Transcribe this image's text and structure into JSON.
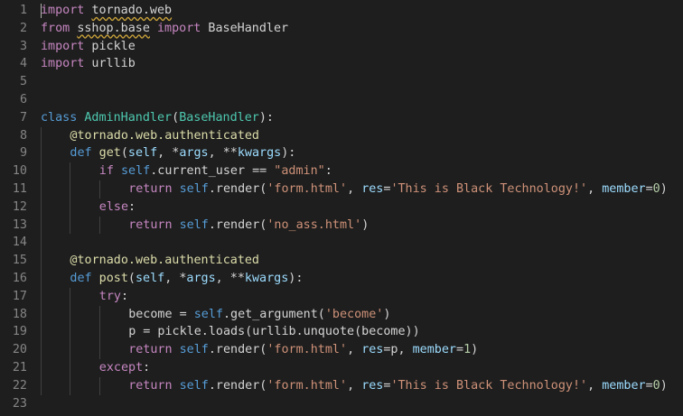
{
  "editor": {
    "language": "python",
    "theme_colors": {
      "background": "#1e1e1e",
      "line_number": "#858585",
      "keyword": "#c586c0",
      "storage_keyword": "#569cd6",
      "class_name": "#4ec9b0",
      "function": "#dcdcaa",
      "parameter": "#9cdcfe",
      "string": "#ce9178",
      "number": "#b5cea8",
      "text": "#d4d4d4",
      "squiggle": "#c9a23a"
    },
    "lines": [
      {
        "number": "1",
        "indent": 0,
        "tokens": [
          {
            "t": "import",
            "c": "kw"
          },
          {
            "t": " ",
            "c": "plain"
          },
          {
            "t": "tornado.web",
            "c": "plain",
            "wavy": true
          }
        ]
      },
      {
        "number": "2",
        "indent": 0,
        "tokens": [
          {
            "t": "from",
            "c": "kw"
          },
          {
            "t": " ",
            "c": "plain"
          },
          {
            "t": "sshop.base",
            "c": "plain",
            "wavy": true
          },
          {
            "t": " ",
            "c": "plain"
          },
          {
            "t": "import",
            "c": "kw"
          },
          {
            "t": " BaseHandler",
            "c": "plain"
          }
        ]
      },
      {
        "number": "3",
        "indent": 0,
        "tokens": [
          {
            "t": "import",
            "c": "kw"
          },
          {
            "t": " pickle",
            "c": "plain"
          }
        ]
      },
      {
        "number": "4",
        "indent": 0,
        "tokens": [
          {
            "t": "import",
            "c": "kw"
          },
          {
            "t": " urllib",
            "c": "plain"
          }
        ]
      },
      {
        "number": "5",
        "indent": 0,
        "tokens": []
      },
      {
        "number": "6",
        "indent": 0,
        "tokens": []
      },
      {
        "number": "7",
        "indent": 0,
        "tokens": [
          {
            "t": "class",
            "c": "kw2"
          },
          {
            "t": " ",
            "c": "plain"
          },
          {
            "t": "AdminHandler",
            "c": "cls"
          },
          {
            "t": "(",
            "c": "plain"
          },
          {
            "t": "BaseHandler",
            "c": "cls"
          },
          {
            "t": "):",
            "c": "plain"
          }
        ]
      },
      {
        "number": "8",
        "indent": 1,
        "tokens": [
          {
            "t": "@tornado.web.authenticated",
            "c": "dec"
          }
        ]
      },
      {
        "number": "9",
        "indent": 1,
        "tokens": [
          {
            "t": "def",
            "c": "kw2"
          },
          {
            "t": " ",
            "c": "plain"
          },
          {
            "t": "get",
            "c": "fn"
          },
          {
            "t": "(",
            "c": "plain"
          },
          {
            "t": "self",
            "c": "param"
          },
          {
            "t": ", *",
            "c": "plain"
          },
          {
            "t": "args",
            "c": "param"
          },
          {
            "t": ", **",
            "c": "plain"
          },
          {
            "t": "kwargs",
            "c": "param"
          },
          {
            "t": "):",
            "c": "plain"
          }
        ]
      },
      {
        "number": "10",
        "indent": 2,
        "tokens": [
          {
            "t": "if",
            "c": "kw"
          },
          {
            "t": " ",
            "c": "plain"
          },
          {
            "t": "self",
            "c": "self"
          },
          {
            "t": ".current_user == ",
            "c": "plain"
          },
          {
            "t": "\"admin\"",
            "c": "str"
          },
          {
            "t": ":",
            "c": "plain"
          }
        ]
      },
      {
        "number": "11",
        "indent": 3,
        "tokens": [
          {
            "t": "return",
            "c": "kw"
          },
          {
            "t": " ",
            "c": "plain"
          },
          {
            "t": "self",
            "c": "self"
          },
          {
            "t": ".render(",
            "c": "plain"
          },
          {
            "t": "'form.html'",
            "c": "str"
          },
          {
            "t": ", ",
            "c": "plain"
          },
          {
            "t": "res",
            "c": "var"
          },
          {
            "t": "=",
            "c": "plain"
          },
          {
            "t": "'This is Black Technology!'",
            "c": "str"
          },
          {
            "t": ", ",
            "c": "plain"
          },
          {
            "t": "member",
            "c": "var"
          },
          {
            "t": "=",
            "c": "plain"
          },
          {
            "t": "0",
            "c": "num"
          },
          {
            "t": ")",
            "c": "plain"
          }
        ]
      },
      {
        "number": "12",
        "indent": 2,
        "tokens": [
          {
            "t": "else",
            "c": "kw"
          },
          {
            "t": ":",
            "c": "plain"
          }
        ]
      },
      {
        "number": "13",
        "indent": 3,
        "tokens": [
          {
            "t": "return",
            "c": "kw"
          },
          {
            "t": " ",
            "c": "plain"
          },
          {
            "t": "self",
            "c": "self"
          },
          {
            "t": ".render(",
            "c": "plain"
          },
          {
            "t": "'no_ass.html'",
            "c": "str"
          },
          {
            "t": ")",
            "c": "plain"
          }
        ]
      },
      {
        "number": "14",
        "indent": 1,
        "tokens": []
      },
      {
        "number": "15",
        "indent": 1,
        "tokens": [
          {
            "t": "@tornado.web.authenticated",
            "c": "dec"
          }
        ]
      },
      {
        "number": "16",
        "indent": 1,
        "tokens": [
          {
            "t": "def",
            "c": "kw2"
          },
          {
            "t": " ",
            "c": "plain"
          },
          {
            "t": "post",
            "c": "fn"
          },
          {
            "t": "(",
            "c": "plain"
          },
          {
            "t": "self",
            "c": "param"
          },
          {
            "t": ", *",
            "c": "plain"
          },
          {
            "t": "args",
            "c": "param"
          },
          {
            "t": ", **",
            "c": "plain"
          },
          {
            "t": "kwargs",
            "c": "param"
          },
          {
            "t": "):",
            "c": "plain"
          }
        ]
      },
      {
        "number": "17",
        "indent": 2,
        "tokens": [
          {
            "t": "try",
            "c": "kw"
          },
          {
            "t": ":",
            "c": "plain"
          }
        ]
      },
      {
        "number": "18",
        "indent": 3,
        "tokens": [
          {
            "t": "become = ",
            "c": "plain"
          },
          {
            "t": "self",
            "c": "self"
          },
          {
            "t": ".get_argument(",
            "c": "plain"
          },
          {
            "t": "'become'",
            "c": "str"
          },
          {
            "t": ")",
            "c": "plain"
          }
        ]
      },
      {
        "number": "19",
        "indent": 3,
        "tokens": [
          {
            "t": "p = pickle.loads(urllib.unquote(become))",
            "c": "plain"
          }
        ]
      },
      {
        "number": "20",
        "indent": 3,
        "tokens": [
          {
            "t": "return",
            "c": "kw"
          },
          {
            "t": " ",
            "c": "plain"
          },
          {
            "t": "self",
            "c": "self"
          },
          {
            "t": ".render(",
            "c": "plain"
          },
          {
            "t": "'form.html'",
            "c": "str"
          },
          {
            "t": ", ",
            "c": "plain"
          },
          {
            "t": "res",
            "c": "var"
          },
          {
            "t": "=p, ",
            "c": "plain"
          },
          {
            "t": "member",
            "c": "var"
          },
          {
            "t": "=",
            "c": "plain"
          },
          {
            "t": "1",
            "c": "num"
          },
          {
            "t": ")",
            "c": "plain"
          }
        ]
      },
      {
        "number": "21",
        "indent": 2,
        "tokens": [
          {
            "t": "except",
            "c": "kw"
          },
          {
            "t": ":",
            "c": "plain"
          }
        ]
      },
      {
        "number": "22",
        "indent": 3,
        "tokens": [
          {
            "t": "return",
            "c": "kw"
          },
          {
            "t": " ",
            "c": "plain"
          },
          {
            "t": "self",
            "c": "self"
          },
          {
            "t": ".render(",
            "c": "plain"
          },
          {
            "t": "'form.html'",
            "c": "str"
          },
          {
            "t": ", ",
            "c": "plain"
          },
          {
            "t": "res",
            "c": "var"
          },
          {
            "t": "=",
            "c": "plain"
          },
          {
            "t": "'This is Black Technology!'",
            "c": "str"
          },
          {
            "t": ", ",
            "c": "plain"
          },
          {
            "t": "member",
            "c": "var"
          },
          {
            "t": "=",
            "c": "plain"
          },
          {
            "t": "0",
            "c": "num"
          },
          {
            "t": ")",
            "c": "plain"
          }
        ]
      },
      {
        "number": "23",
        "indent": 0,
        "tokens": []
      }
    ]
  }
}
